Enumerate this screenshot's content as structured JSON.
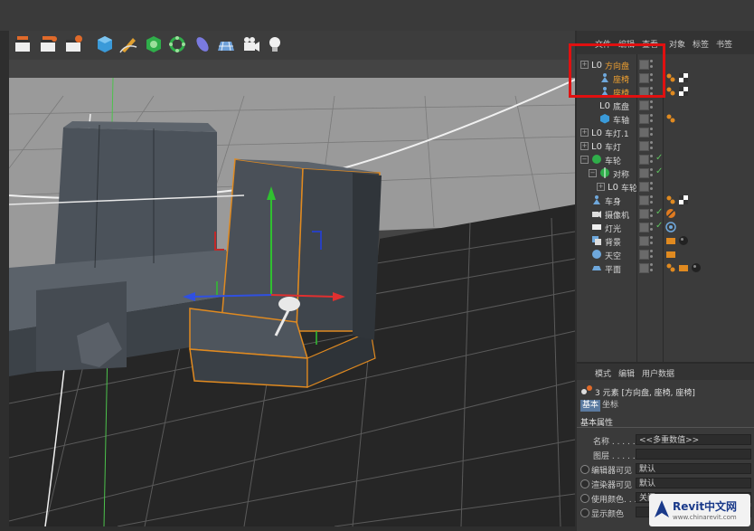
{
  "menu": {
    "objects_menu": [
      "文件",
      "编辑",
      "查看",
      "对象",
      "标签",
      "书签"
    ],
    "attr_menu": [
      "模式",
      "编辑",
      "用户数据"
    ]
  },
  "objects": [
    {
      "name": "方向盘",
      "icon": "null-object-icon",
      "expand": "+",
      "depth": 0,
      "selected": true,
      "vis": true,
      "tags": []
    },
    {
      "name": "座椅",
      "icon": "figure-object-icon",
      "expand": "",
      "depth": 1,
      "selected": true,
      "vis": true,
      "tags": [
        "material-tag-orange",
        "checker-tag"
      ]
    },
    {
      "name": "座椅",
      "icon": "figure-object-icon",
      "expand": "",
      "depth": 1,
      "selected": true,
      "vis": true,
      "tags": [
        "material-tag-orange",
        "checker-tag"
      ]
    },
    {
      "name": "底盘",
      "icon": "null-object-icon",
      "expand": "",
      "depth": 1,
      "selected": false,
      "vis": true,
      "tags": []
    },
    {
      "name": "车轴",
      "icon": "cube-object-icon",
      "expand": "",
      "depth": 1,
      "selected": false,
      "vis": true,
      "tags": [
        "material-tag-orange"
      ]
    },
    {
      "name": "车灯.1",
      "icon": "null-object-icon",
      "expand": "+",
      "depth": 0,
      "selected": false,
      "vis": true,
      "tags": []
    },
    {
      "name": "车灯",
      "icon": "null-object-icon",
      "expand": "+",
      "depth": 0,
      "selected": false,
      "vis": true,
      "tags": []
    },
    {
      "name": "车轮",
      "icon": "sphere-object-icon",
      "expand": "−",
      "depth": 0,
      "selected": false,
      "vis": true,
      "check": true,
      "tags": []
    },
    {
      "name": "对称",
      "icon": "symmetry-object-icon",
      "expand": "−",
      "depth": 1,
      "selected": false,
      "vis": true,
      "check": true,
      "tags": []
    },
    {
      "name": "车轮",
      "icon": "null-object-icon",
      "expand": "+",
      "depth": 2,
      "selected": false,
      "vis": true,
      "tags": []
    },
    {
      "name": "车身",
      "icon": "figure-object-icon",
      "expand": "",
      "depth": 0,
      "selected": false,
      "vis": true,
      "tags": [
        "material-tag-orange",
        "checker-tag"
      ]
    },
    {
      "name": "摄像机",
      "icon": "camera-object-icon",
      "expand": "",
      "depth": 0,
      "selected": false,
      "vis": true,
      "check": true,
      "tags": [
        "protection-tag"
      ]
    },
    {
      "name": "灯光",
      "icon": "light-object-icon",
      "expand": "",
      "depth": 0,
      "selected": false,
      "vis": true,
      "check": true,
      "tags": [
        "target-tag"
      ]
    },
    {
      "name": "背景",
      "icon": "background-object-icon",
      "expand": "",
      "depth": 0,
      "selected": false,
      "vis": true,
      "tags": [
        "display-tag",
        "sphere-material-tag"
      ]
    },
    {
      "name": "天空",
      "icon": "sky-object-icon",
      "expand": "",
      "depth": 0,
      "selected": false,
      "vis": true,
      "tags": [
        "display-tag"
      ]
    },
    {
      "name": "平面",
      "icon": "plane-object-icon",
      "expand": "",
      "depth": 0,
      "selected": false,
      "vis": true,
      "tags": [
        "material-tag-orange",
        "display-tag",
        "sphere-material-tag"
      ]
    }
  ],
  "attributes": {
    "summary": "3 元素 [方向盘, 座椅, 座椅]",
    "tabs": [
      "基本",
      "坐标"
    ],
    "section": "基本属性",
    "fields": [
      {
        "label": "名称 . . . . .",
        "value": "<<多重数值>>"
      },
      {
        "label": "图层 . . . . .",
        "value": ""
      },
      {
        "label": "编辑器可见",
        "value": "默认"
      },
      {
        "label": "渲染器可见",
        "value": "默认"
      },
      {
        "label": "使用颜色. . .",
        "value": "关闭"
      },
      {
        "label": "显示颜色",
        "value": ""
      }
    ]
  },
  "watermark": {
    "title": "Revit中文网",
    "url": "www.chinarevit.com"
  },
  "colors": {
    "selected_text": "#f0a030",
    "highlight_box": "#e01010",
    "axis_x": "#e03030",
    "axis_y": "#30c030",
    "axis_z": "#3050e0",
    "selection_outline": "#e08a20"
  }
}
